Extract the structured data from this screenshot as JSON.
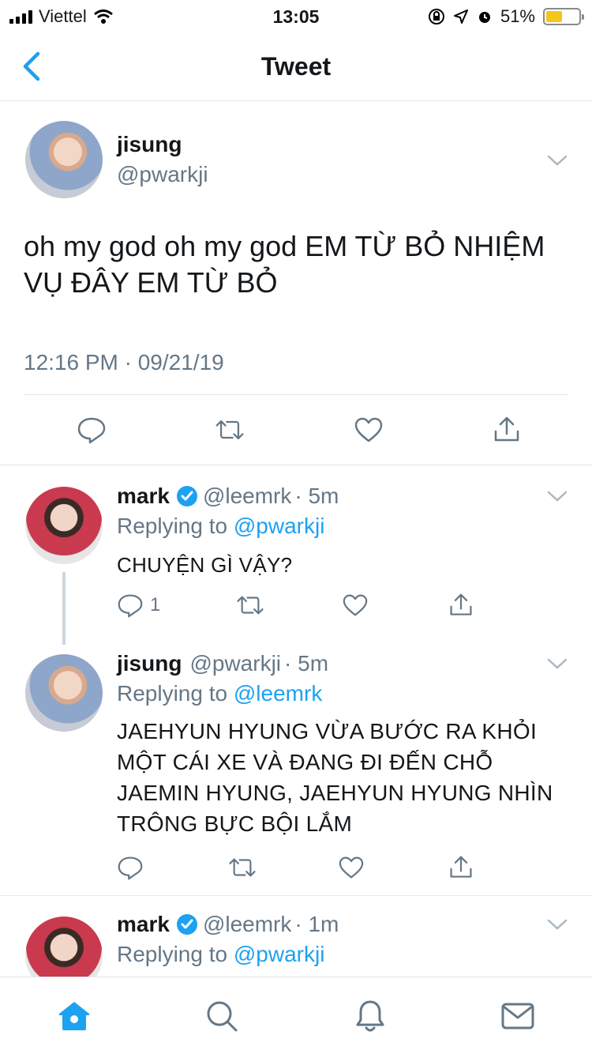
{
  "status_bar": {
    "carrier": "Viettel",
    "time": "13:05",
    "battery": "51%",
    "battery_level": 0.51
  },
  "nav": {
    "title": "Tweet"
  },
  "main_tweet": {
    "name": "jisung",
    "handle": "@pwarkji",
    "text": "oh my god oh my god EM TỪ BỎ NHIỆM VỤ ĐÂY EM TỪ BỎ",
    "timestamp": "12:16 PM · 09/21/19"
  },
  "replies": [
    {
      "name": "mark",
      "handle": "@leemrk",
      "time": "· 5m",
      "verified": true,
      "replying_prefix": "Replying to",
      "replying_to": "@pwarkji",
      "text": "CHUYỆN GÌ VẬY?",
      "reply_count": "1"
    },
    {
      "name": "jisung",
      "handle": "@pwarkji",
      "time": "· 5m",
      "verified": false,
      "replying_prefix": "Replying to",
      "replying_to": "@leemrk",
      "text_lines": [
        "JAEHYUN HYUNG VỪA BƯỚC RA KHỎI",
        "MỘT CÁI XE VÀ ĐANG ĐI ĐẾN CHỖ",
        "JAEMIN HYUNG, JAEHYUN HYUNG NHÌN",
        "TRÔNG BỰC BỘI LẮM"
      ],
      "reply_count": ""
    },
    {
      "name": "mark",
      "handle": "@leemrk",
      "time": "· 1m",
      "verified": true,
      "replying_prefix": "Replying to",
      "replying_to": "@pwarkji"
    }
  ],
  "colors": {
    "accent": "#1da1f2",
    "gray": "#657786",
    "divider": "#e1e8ed"
  },
  "icons": {
    "tabbar": [
      "home-icon",
      "search-icon",
      "bell-icon",
      "mail-icon"
    ],
    "actions": [
      "reply-icon",
      "retweet-icon",
      "like-icon",
      "share-icon"
    ]
  }
}
